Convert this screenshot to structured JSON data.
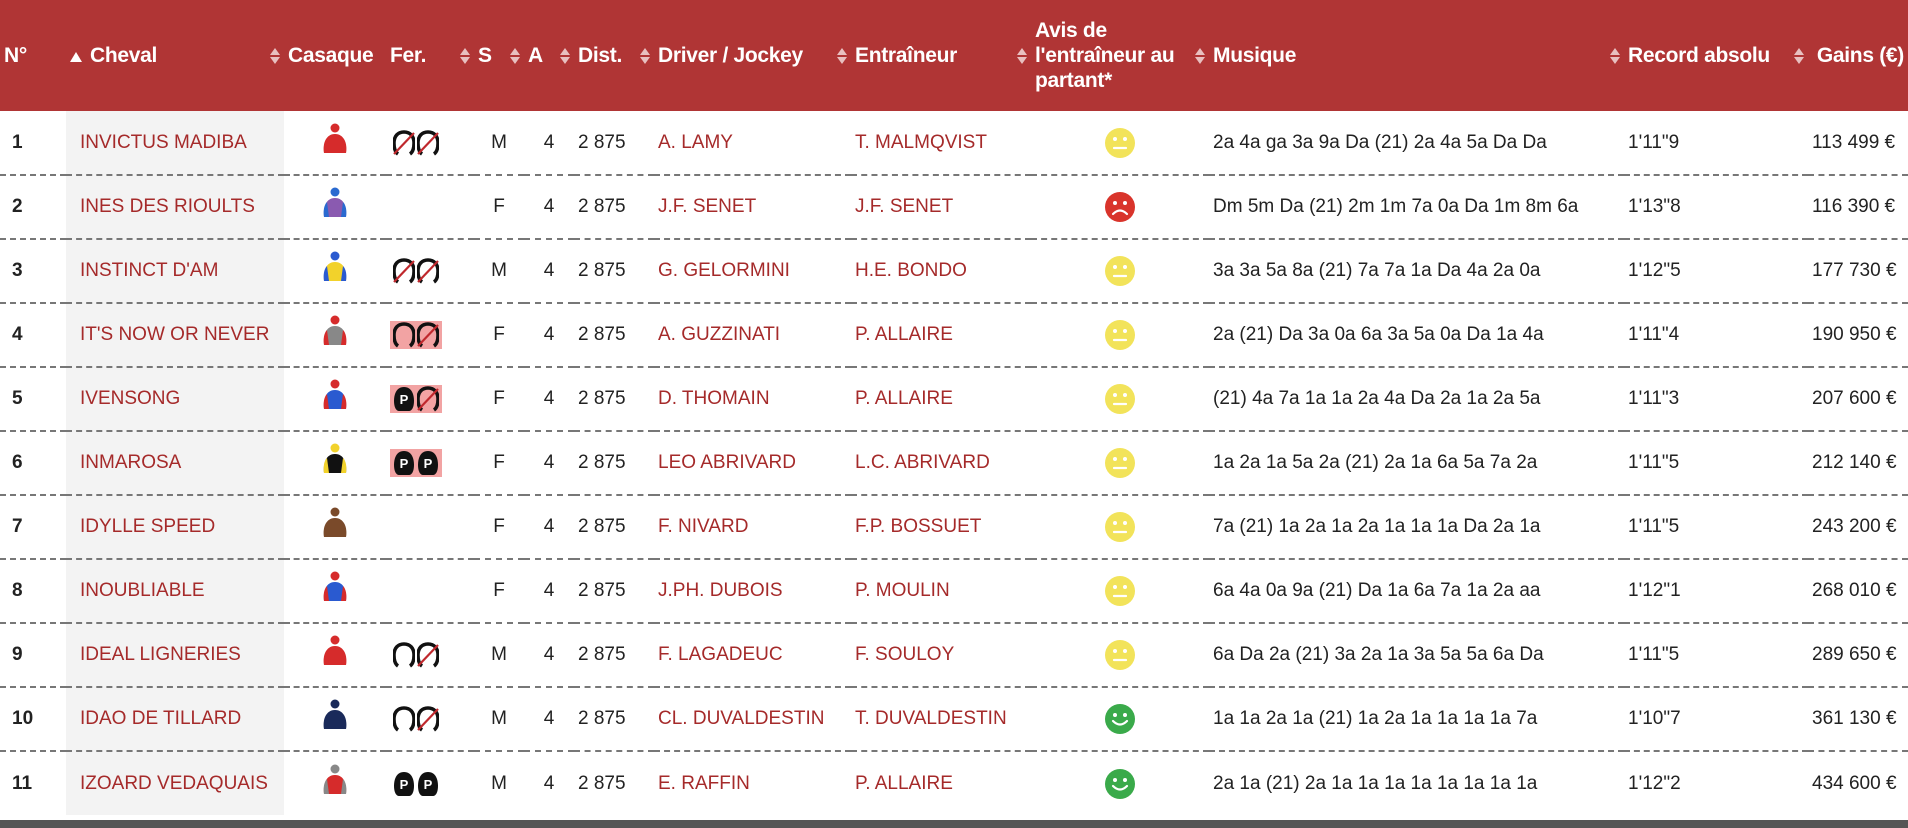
{
  "headers": {
    "num": "N°",
    "cheval": "Cheval",
    "casaque": "Casaque",
    "fer": "Fer.",
    "s": "S",
    "a": "A",
    "dist": "Dist.",
    "driver": "Driver / Jockey",
    "entraineur": "Entraîneur",
    "avis": "Avis de l'entraîneur au partant*",
    "musique": "Musique",
    "record": "Record absolu",
    "gains": "Gains (€)"
  },
  "colors": {
    "header_bg": "#b03535",
    "link": "#a52a2a",
    "happy": "#3aaa4a",
    "neutral": "#f2e35a",
    "sad": "#d9342b"
  },
  "rows": [
    {
      "num": "1",
      "cheval": "INVICTUS MADIBA",
      "silk": [
        "#d62b2b",
        "#d62b2b"
      ],
      "fer": [
        "barred",
        "barred"
      ],
      "fer_bg": "none",
      "s": "M",
      "a": "4",
      "dist": "2 875",
      "driver": "A. LAMY",
      "entraineur": "T. MALMQVIST",
      "avis": "neutral",
      "musique": "2a 4a ga 3a 9a Da (21) 2a 4a 5a Da Da",
      "record": "1'11\"9",
      "gains": "113 499 €"
    },
    {
      "num": "2",
      "cheval": "INES DES RIOULTS",
      "silk": [
        "#8a5ab0",
        "#2a6ad0"
      ],
      "fer": [],
      "fer_bg": "none",
      "s": "F",
      "a": "4",
      "dist": "2 875",
      "driver": "J.F. SENET",
      "entraineur": "J.F. SENET",
      "avis": "sad",
      "musique": "Dm 5m Da (21) 2m 1m 7a 0a Da 1m 8m 6a",
      "record": "1'13\"8",
      "gains": "116 390 €"
    },
    {
      "num": "3",
      "cheval": "INSTINCT D'AM",
      "silk": [
        "#f2d22b",
        "#2a5ad0"
      ],
      "fer": [
        "barred",
        "barred"
      ],
      "fer_bg": "none",
      "s": "M",
      "a": "4",
      "dist": "2 875",
      "driver": "G. GELORMINI",
      "entraineur": "H.E. BONDO",
      "avis": "neutral",
      "musique": "3a 3a 5a 8a (21) 7a 7a 1a Da 4a 2a 0a",
      "record": "1'12\"5",
      "gains": "177 730 €"
    },
    {
      "num": "4",
      "cheval": "IT'S NOW OR NEVER",
      "silk": [
        "#888888",
        "#d62b2b"
      ],
      "fer": [
        "open",
        "barred"
      ],
      "fer_bg": "pink",
      "s": "F",
      "a": "4",
      "dist": "2 875",
      "driver": "A. GUZZINATI",
      "entraineur": "P. ALLAIRE",
      "avis": "neutral",
      "musique": "2a (21) Da 3a 0a 6a 3a 5a 0a Da 1a 4a",
      "record": "1'11\"4",
      "gains": "190 950 €"
    },
    {
      "num": "5",
      "cheval": "IVENSONG",
      "silk": [
        "#2a5ad0",
        "#d62b2b"
      ],
      "fer": [
        "p",
        "barred"
      ],
      "fer_bg": "pink",
      "s": "F",
      "a": "4",
      "dist": "2 875",
      "driver": "D. THOMAIN",
      "entraineur": "P. ALLAIRE",
      "avis": "neutral",
      "musique": "(21) 4a 7a 1a 1a 2a 4a Da 2a 1a 2a 5a",
      "record": "1'11\"3",
      "gains": "207 600 €"
    },
    {
      "num": "6",
      "cheval": "INMAROSA",
      "silk": [
        "#111111",
        "#f2d22b"
      ],
      "fer": [
        "p",
        "p"
      ],
      "fer_bg": "pink",
      "s": "F",
      "a": "4",
      "dist": "2 875",
      "driver": "LEO ABRIVARD",
      "entraineur": "L.C. ABRIVARD",
      "avis": "neutral",
      "musique": "1a 2a 1a 5a 2a (21) 2a 1a 6a 5a 7a 2a",
      "record": "1'11\"5",
      "gains": "212 140 €"
    },
    {
      "num": "7",
      "cheval": "IDYLLE SPEED",
      "silk": [
        "#7a4a2a",
        "#7a4a2a"
      ],
      "fer": [],
      "fer_bg": "none",
      "s": "F",
      "a": "4",
      "dist": "2 875",
      "driver": "F. NIVARD",
      "entraineur": "F.P. BOSSUET",
      "avis": "neutral",
      "musique": "7a (21) 1a 2a 1a 2a 1a 1a 1a Da 2a 1a",
      "record": "1'11\"5",
      "gains": "243 200 €"
    },
    {
      "num": "8",
      "cheval": "INOUBLIABLE",
      "silk": [
        "#2a5ad0",
        "#d62b2b"
      ],
      "fer": [],
      "fer_bg": "none",
      "s": "F",
      "a": "4",
      "dist": "2 875",
      "driver": "J.PH. DUBOIS",
      "entraineur": "P. MOULIN",
      "avis": "neutral",
      "musique": "6a 4a 0a 9a (21) Da 1a 6a 7a 1a 2a aa",
      "record": "1'12\"1",
      "gains": "268 010 €"
    },
    {
      "num": "9",
      "cheval": "IDEAL LIGNERIES",
      "silk": [
        "#d62b2b",
        "#d62b2b"
      ],
      "fer": [
        "open",
        "barred"
      ],
      "fer_bg": "none",
      "s": "M",
      "a": "4",
      "dist": "2 875",
      "driver": "F. LAGADEUC",
      "entraineur": "F. SOULOY",
      "avis": "neutral",
      "musique": "6a Da 2a (21) 3a 2a 1a 3a 5a 5a 6a Da",
      "record": "1'11\"5",
      "gains": "289 650 €"
    },
    {
      "num": "10",
      "cheval": "IDAO DE TILLARD",
      "silk": [
        "#1a2a5a",
        "#1a2a5a"
      ],
      "fer": [
        "open",
        "barred"
      ],
      "fer_bg": "none",
      "s": "M",
      "a": "4",
      "dist": "2 875",
      "driver": "CL. DUVALDESTIN",
      "entraineur": "T. DUVALDESTIN",
      "avis": "happy",
      "musique": "1a 1a 2a 1a (21) 1a 2a 1a 1a 1a 1a 7a",
      "record": "1'10\"7",
      "gains": "361 130 €"
    },
    {
      "num": "11",
      "cheval": "IZOARD VEDAQUAIS",
      "silk": [
        "#d62b2b",
        "#888888"
      ],
      "fer": [
        "p",
        "p"
      ],
      "fer_bg": "none",
      "s": "M",
      "a": "4",
      "dist": "2 875",
      "driver": "E. RAFFIN",
      "entraineur": "P. ALLAIRE",
      "avis": "happy",
      "musique": "2a 1a (21) 2a 1a 1a 1a 1a 1a 1a 1a 1a",
      "record": "1'12\"2",
      "gains": "434 600 €"
    }
  ]
}
